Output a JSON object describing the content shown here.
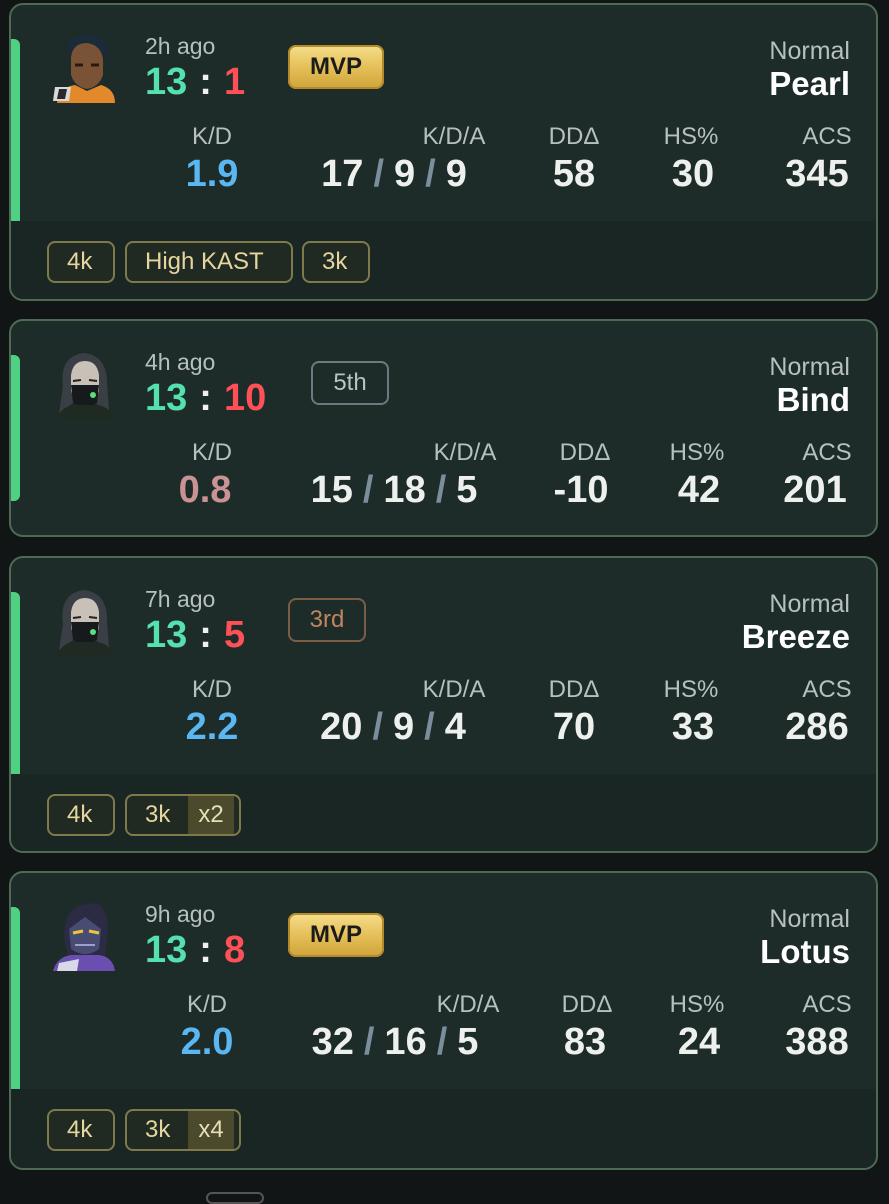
{
  "matches": [
    {
      "time_ago": "2h ago",
      "score_win": "13",
      "score_sep": ":",
      "score_loss": "1",
      "badge": "MVP",
      "badge_type": "mvp",
      "mode": "Normal",
      "map": "Pearl",
      "agent_icon": "agent-portrait-neon",
      "stats": {
        "kd_label": "K/D",
        "kd": "1.9",
        "kd_color": "#5bb7f2",
        "kda_label": "K/D/A",
        "kills": "17",
        "deaths": "9",
        "assists": "9",
        "dd_label": "DDΔ",
        "dd": "58",
        "hs_label": "HS%",
        "hs": "30",
        "acs_label": "ACS",
        "acs": "345"
      },
      "tags": [
        {
          "label": "4k"
        },
        {
          "label": "High KAST"
        },
        {
          "label": "3k"
        }
      ]
    },
    {
      "time_ago": "4h ago",
      "score_win": "13",
      "score_sep": ":",
      "score_loss": "10",
      "badge": "5th",
      "badge_type": "place",
      "mode": "Normal",
      "map": "Bind",
      "agent_icon": "agent-portrait-viper",
      "stats": {
        "kd_label": "K/D",
        "kd": "0.8",
        "kd_color": "#c99396",
        "kda_label": "K/D/A",
        "kills": "15",
        "deaths": "18",
        "assists": "5",
        "dd_label": "DDΔ",
        "dd": "-10",
        "hs_label": "HS%",
        "hs": "42",
        "acs_label": "ACS",
        "acs": "201"
      },
      "tags": []
    },
    {
      "time_ago": "7h ago",
      "score_win": "13",
      "score_sep": ":",
      "score_loss": "5",
      "badge": "3rd",
      "badge_type": "place",
      "mode": "Normal",
      "map": "Breeze",
      "agent_icon": "agent-portrait-viper",
      "stats": {
        "kd_label": "K/D",
        "kd": "2.2",
        "kd_color": "#5bb7f2",
        "kda_label": "K/D/A",
        "kills": "20",
        "deaths": "9",
        "assists": "4",
        "dd_label": "DDΔ",
        "dd": "70",
        "hs_label": "HS%",
        "hs": "33",
        "acs_label": "ACS",
        "acs": "286"
      },
      "tags": [
        {
          "label": "4k"
        },
        {
          "label": "3k",
          "mult": "x2"
        }
      ]
    },
    {
      "time_ago": "9h ago",
      "score_win": "13",
      "score_sep": ":",
      "score_loss": "8",
      "badge": "MVP",
      "badge_type": "mvp",
      "mode": "Normal",
      "map": "Lotus",
      "agent_icon": "agent-portrait-iso",
      "stats": {
        "kd_label": "K/D",
        "kd": "2.0",
        "kd_color": "#5bb7f2",
        "kda_label": "K/D/A",
        "kills": "32",
        "deaths": "16",
        "assists": "5",
        "dd_label": "DDΔ",
        "dd": "83",
        "hs_label": "HS%",
        "hs": "24",
        "acs_label": "ACS",
        "acs": "388"
      },
      "tags": [
        {
          "label": "4k"
        },
        {
          "label": "3k",
          "mult": "x4"
        }
      ]
    }
  ]
}
